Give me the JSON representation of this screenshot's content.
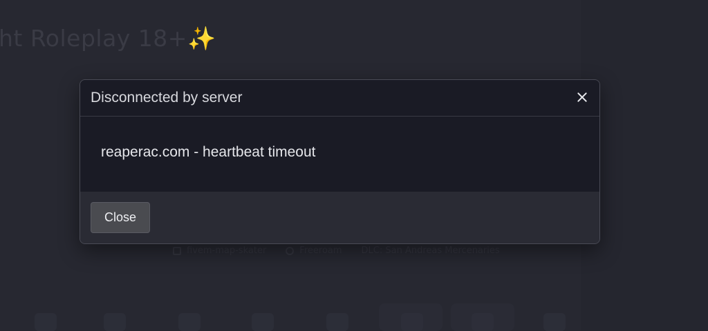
{
  "background": {
    "server_title": "ht Roleplay 18+",
    "title_emoji": "✨",
    "meta": [
      {
        "icon": "map-icon",
        "label": "fivem-map-skater"
      },
      {
        "icon": "gamepad-icon",
        "label": "Freeroam"
      },
      {
        "icon": "dlc-icon",
        "label": "DLC: San Andreas Mercenaries"
      }
    ]
  },
  "dialog": {
    "title": "Disconnected by server",
    "message": "reaperac.com - heartbeat timeout",
    "close_button_label": "Close",
    "close_icon": "close-icon"
  },
  "colors": {
    "backdrop": "#25262f",
    "modal_header_bg": "#1a1b25",
    "modal_footer_bg": "#2a2b34",
    "button_bg": "#4a4b50"
  }
}
